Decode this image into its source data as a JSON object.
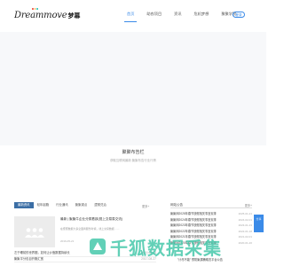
{
  "brand": {
    "name": "Dreammove",
    "name_cn": "梦幕",
    "dot_colors": [
      "#e94b3c",
      "#f5a623",
      "#2ec4b6"
    ]
  },
  "nav": {
    "items": [
      {
        "label": "首页",
        "active": true
      },
      {
        "label": "助农项目",
        "active": false
      },
      {
        "label": "资讯",
        "active": false
      },
      {
        "label": "危机梦想",
        "active": false
      },
      {
        "label": "聚聚学院",
        "active": false
      }
    ],
    "login_label": "登录"
  },
  "section": {
    "title": "聚聚布告栏",
    "subtitle": "获取互联网最新 聚聚布告行业行情"
  },
  "left_panel": {
    "tabs": [
      {
        "label": "最新资讯",
        "active": true
      },
      {
        "label": "轻年起跑",
        "active": false
      },
      {
        "label": "行业通讯",
        "active": false
      },
      {
        "label": "聚聚观点",
        "active": false
      },
      {
        "label": "逻辑兑治",
        "active": false
      }
    ],
    "more_label": "更多+",
    "featured": {
      "title": "最新 | 聚聚牛企业分类看孩(视上交易易交流)",
      "desc": "在聚聚数据大多全面商服务时候，线上交易数据……",
      "date": "2016-05-21"
    },
    "list": [
      {
        "title": "左于睡前的世界圈，如何让价值数据持续长",
        "date": "2016-08-13"
      },
      {
        "title": "聚聚平分包目开跑汇宽",
        "date": "2017-08-27"
      }
    ]
  },
  "right_panel": {
    "title": "网站公告",
    "more_label": "更多+",
    "items": [
      {
        "title": "聚聚网2025年春节放假相关事宜安排",
        "date": "2025-01-21"
      },
      {
        "title": "聚聚网2024年春节放假相关事宜安排",
        "date": "2024-02-01"
      },
      {
        "title": "聚聚网2023年春节放假相关事宜安排",
        "date": "2023-01-13"
      },
      {
        "title": "聚聚网2022年春节放假相关事宜安排",
        "date": "2022-01-18"
      },
      {
        "title": "聚聚网2021年春节放假相关事宜安排",
        "date": "2021-02-01"
      },
      {
        "title": "聚聚网2020年春节放假相关事宜安排",
        "date": "2020-01-20"
      }
    ],
    "extra_label": "\"计尽不能\" 预防聚漏桶助农平台公告"
  },
  "side_badge": {
    "label": "分享"
  },
  "watermark": {
    "text": "千狐数据采集",
    "color": "#46c8aa"
  }
}
